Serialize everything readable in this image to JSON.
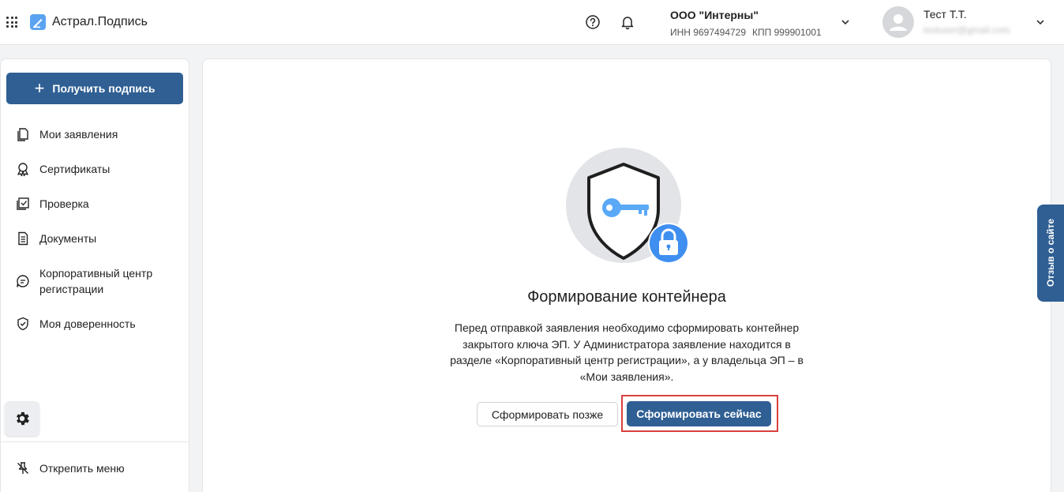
{
  "header": {
    "app_title": "Астрал.Подпись",
    "org": {
      "name": "ООО \"Интерны\"",
      "inn": "ИНН 9697494729",
      "kpp": "КПП 999901001"
    },
    "user": {
      "name": "Тест Т.Т.",
      "email": "testuser@gmail.com"
    }
  },
  "sidebar": {
    "get_signature_label": "Получить подпись",
    "items": [
      {
        "label": "Мои заявления",
        "icon": "documents-icon"
      },
      {
        "label": "Сертификаты",
        "icon": "certificate-icon"
      },
      {
        "label": "Проверка",
        "icon": "check-icon"
      },
      {
        "label": "Документы",
        "icon": "document-icon"
      },
      {
        "label": "Корпоративный центр регистрации",
        "icon": "chat-icon"
      },
      {
        "label": "Моя доверенность",
        "icon": "shield-check-icon"
      }
    ],
    "unpin_label": "Открепить меню"
  },
  "main": {
    "title": "Формирование контейнера",
    "description": "Перед отправкой заявления необходимо сформировать контейнер закрытого ключа ЭП. У Администратора заявление находится в разделе «Корпоративный центр регистрации», а у владельца ЭП – в «Мои заявления».",
    "later_button": "Сформировать позже",
    "now_button": "Сформировать сейчас"
  },
  "feedback_label": "Отзыв о сайте",
  "colors": {
    "primary": "#2f5f93",
    "highlight_outline": "#d9403f",
    "key_blue": "#4a9ff5"
  }
}
